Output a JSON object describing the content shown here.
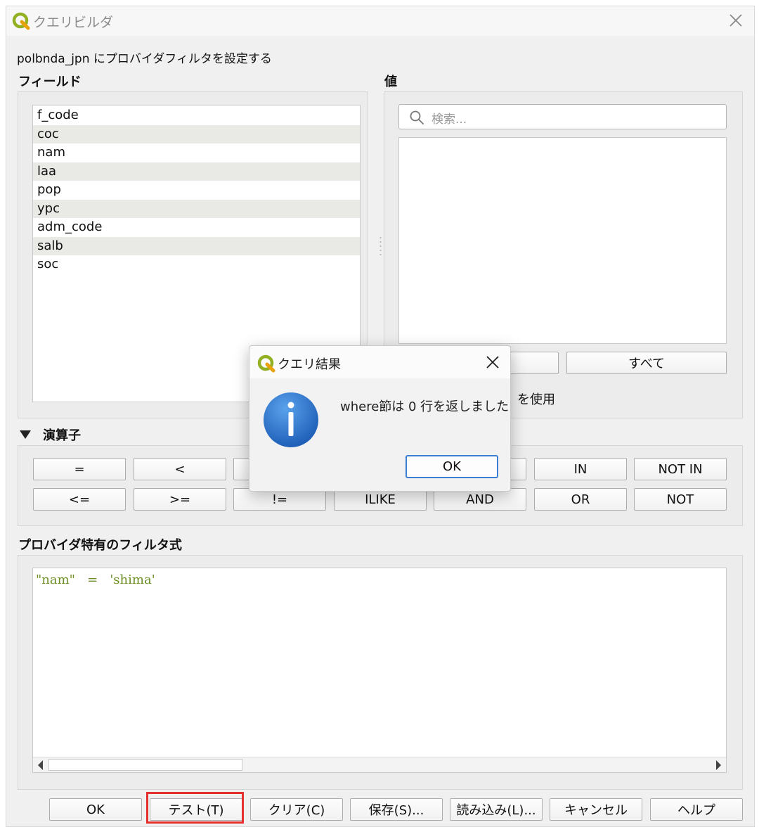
{
  "window": {
    "title": "クエリビルダ",
    "subtitle": "polbnda_jpn にプロバイダフィルタを設定する"
  },
  "fields": {
    "label": "フィールド",
    "items": [
      "f_code",
      "coc",
      "nam",
      "laa",
      "pop",
      "ypc",
      "adm_code",
      "salb",
      "soc"
    ]
  },
  "values": {
    "label": "値",
    "search_placeholder": "検索...",
    "all_button": "すべて",
    "use_layer_text": "を使用"
  },
  "operators": {
    "label": "演算子",
    "row1": [
      "=",
      "<",
      "",
      "",
      "",
      "IN",
      "NOT IN"
    ],
    "row2": [
      "<=",
      ">=",
      "!=",
      "ILIKE",
      "AND",
      "OR",
      "NOT"
    ]
  },
  "expression": {
    "label": "プロバイダ特有のフィルタ式",
    "text": "\"nam\"   =   'shima'"
  },
  "buttons": {
    "ok": "OK",
    "test": "テスト(T)",
    "clear": "クリア(C)",
    "save": "保存(S)...",
    "load": "読み込み(L)...",
    "cancel": "キャンセル",
    "help": "ヘルプ"
  },
  "message_box": {
    "title": "クエリ結果",
    "text": "where節は 0 行を返しました",
    "ok": "OK"
  },
  "colors": {
    "highlight": "#e53030",
    "qgis_green": "#93b023",
    "info_blue": "#2f74c9"
  }
}
